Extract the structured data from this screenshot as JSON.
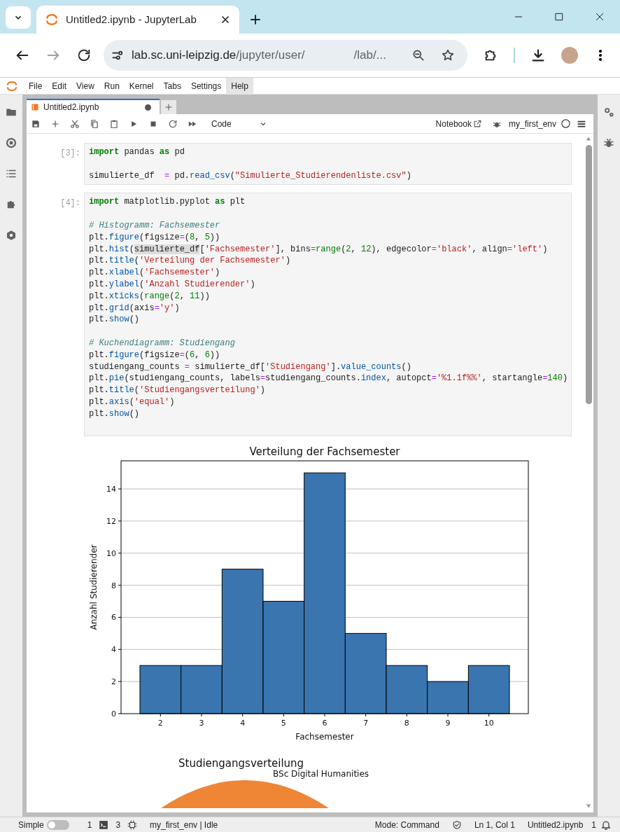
{
  "browser": {
    "tab_title": "Untitled2.ipynb - JupyterLab",
    "url_host": "lab.sc.uni-leipzig.de",
    "url_path": "/jupyter/user/",
    "url_tail": "/lab/...",
    "forward_disabled": true
  },
  "menu": [
    {
      "label": "File",
      "selected": false
    },
    {
      "label": "Edit",
      "selected": false
    },
    {
      "label": "View",
      "selected": false
    },
    {
      "label": "Run",
      "selected": false
    },
    {
      "label": "Kernel",
      "selected": false
    },
    {
      "label": "Tabs",
      "selected": false
    },
    {
      "label": "Settings",
      "selected": false
    },
    {
      "label": "Help",
      "selected": true
    }
  ],
  "document_tab": {
    "title": "Untitled2.ipynb",
    "modified": true
  },
  "toolbar": {
    "cell_type": "Code",
    "notebook_link": "Notebook",
    "kernel": "my_first_env"
  },
  "cells": [
    {
      "prompt": "[3]:",
      "blocks": [
        [
          [
            {
              "text": "import",
              "kind": "kw"
            },
            {
              "text": " pandas ",
              "kind": "p"
            },
            {
              "text": "as",
              "kind": "kw"
            },
            {
              "text": " pd",
              "kind": "p"
            }
          ]
        ],
        [
          [
            {
              "text": "simulierte_df  ",
              "kind": "p"
            },
            {
              "text": "=",
              "kind": "op"
            },
            {
              "text": " pd.",
              "kind": "p"
            },
            {
              "text": "read_csv",
              "kind": "fn"
            },
            {
              "text": "(",
              "kind": "p"
            },
            {
              "text": "\"Simulierte_Studierendenliste.csv\"",
              "kind": "str"
            },
            {
              "text": ")",
              "kind": "p"
            }
          ]
        ]
      ]
    },
    {
      "prompt": "[4]:",
      "blocks": [
        [
          [
            {
              "text": "import",
              "kind": "kw"
            },
            {
              "text": " matplotlib.pyplot ",
              "kind": "p"
            },
            {
              "text": "as",
              "kind": "kw"
            },
            {
              "text": " plt",
              "kind": "p"
            }
          ]
        ],
        [
          [
            {
              "text": "# Histogramm: Fachsemester",
              "kind": "cm"
            }
          ],
          [
            {
              "text": "plt.",
              "kind": "p"
            },
            {
              "text": "figure",
              "kind": "fn"
            },
            {
              "text": "(figsize",
              "kind": "p"
            },
            {
              "text": "=",
              "kind": "op"
            },
            {
              "text": "(",
              "kind": "p"
            },
            {
              "text": "8",
              "kind": "num"
            },
            {
              "text": ", ",
              "kind": "p"
            },
            {
              "text": "5",
              "kind": "num"
            },
            {
              "text": "))",
              "kind": "p"
            }
          ],
          [
            {
              "text": "plt.",
              "kind": "p"
            },
            {
              "text": "hist",
              "kind": "fn"
            },
            {
              "text": "(",
              "kind": "p"
            },
            {
              "text": "simulierte_df",
              "kind": "hl"
            },
            {
              "text": "[",
              "kind": "p"
            },
            {
              "text": "'Fachsemester'",
              "kind": "str"
            },
            {
              "text": "], bins",
              "kind": "p"
            },
            {
              "text": "=",
              "kind": "op"
            },
            {
              "text": "range",
              "kind": "bi"
            },
            {
              "text": "(",
              "kind": "p"
            },
            {
              "text": "2",
              "kind": "num"
            },
            {
              "text": ", ",
              "kind": "p"
            },
            {
              "text": "12",
              "kind": "num"
            },
            {
              "text": "), edgecolor",
              "kind": "p"
            },
            {
              "text": "=",
              "kind": "op"
            },
            {
              "text": "'black'",
              "kind": "str"
            },
            {
              "text": ", align",
              "kind": "p"
            },
            {
              "text": "=",
              "kind": "op"
            },
            {
              "text": "'left'",
              "kind": "str"
            },
            {
              "text": ")",
              "kind": "p"
            }
          ],
          [
            {
              "text": "plt.",
              "kind": "p"
            },
            {
              "text": "title",
              "kind": "fn"
            },
            {
              "text": "(",
              "kind": "p"
            },
            {
              "text": "'Verteilung der Fachsemester'",
              "kind": "str"
            },
            {
              "text": ")",
              "kind": "p"
            }
          ],
          [
            {
              "text": "plt.",
              "kind": "p"
            },
            {
              "text": "xlabel",
              "kind": "fn"
            },
            {
              "text": "(",
              "kind": "p"
            },
            {
              "text": "'Fachsemester'",
              "kind": "str"
            },
            {
              "text": ")",
              "kind": "p"
            }
          ],
          [
            {
              "text": "plt.",
              "kind": "p"
            },
            {
              "text": "ylabel",
              "kind": "fn"
            },
            {
              "text": "(",
              "kind": "p"
            },
            {
              "text": "'Anzahl Studierender'",
              "kind": "str"
            },
            {
              "text": ")",
              "kind": "p"
            }
          ],
          [
            {
              "text": "plt.",
              "kind": "p"
            },
            {
              "text": "xticks",
              "kind": "fn"
            },
            {
              "text": "(",
              "kind": "p"
            },
            {
              "text": "range",
              "kind": "bi"
            },
            {
              "text": "(",
              "kind": "p"
            },
            {
              "text": "2",
              "kind": "num"
            },
            {
              "text": ", ",
              "kind": "p"
            },
            {
              "text": "11",
              "kind": "num"
            },
            {
              "text": "))",
              "kind": "p"
            }
          ],
          [
            {
              "text": "plt.",
              "kind": "p"
            },
            {
              "text": "grid",
              "kind": "fn"
            },
            {
              "text": "(axis",
              "kind": "p"
            },
            {
              "text": "=",
              "kind": "op"
            },
            {
              "text": "'y'",
              "kind": "str"
            },
            {
              "text": ")",
              "kind": "p"
            }
          ],
          [
            {
              "text": "plt.",
              "kind": "p"
            },
            {
              "text": "show",
              "kind": "fn"
            },
            {
              "text": "()",
              "kind": "p"
            }
          ]
        ],
        [
          [
            {
              "text": "# Kuchendiagramm: Studiengang",
              "kind": "cm"
            }
          ],
          [
            {
              "text": "plt.",
              "kind": "p"
            },
            {
              "text": "figure",
              "kind": "fn"
            },
            {
              "text": "(figsize",
              "kind": "p"
            },
            {
              "text": "=",
              "kind": "op"
            },
            {
              "text": "(",
              "kind": "p"
            },
            {
              "text": "6",
              "kind": "num"
            },
            {
              "text": ", ",
              "kind": "p"
            },
            {
              "text": "6",
              "kind": "num"
            },
            {
              "text": "))",
              "kind": "p"
            }
          ],
          [
            {
              "text": "studiengang_counts ",
              "kind": "p"
            },
            {
              "text": "=",
              "kind": "op"
            },
            {
              "text": " simulierte_df[",
              "kind": "p"
            },
            {
              "text": "'Studiengang'",
              "kind": "str"
            },
            {
              "text": "].",
              "kind": "p"
            },
            {
              "text": "value_counts",
              "kind": "fn"
            },
            {
              "text": "()",
              "kind": "p"
            }
          ],
          [
            {
              "text": "plt.",
              "kind": "p"
            },
            {
              "text": "pie",
              "kind": "fn"
            },
            {
              "text": "(studiengang_counts, labels",
              "kind": "p"
            },
            {
              "text": "=",
              "kind": "op"
            },
            {
              "text": "studiengang_counts.",
              "kind": "p"
            },
            {
              "text": "index",
              "kind": "fn"
            },
            {
              "text": ", autopct",
              "kind": "p"
            },
            {
              "text": "=",
              "kind": "op"
            },
            {
              "text": "'%1.1f%%'",
              "kind": "str"
            },
            {
              "text": ", startangle",
              "kind": "p"
            },
            {
              "text": "=",
              "kind": "op"
            },
            {
              "text": "140",
              "kind": "num"
            },
            {
              "text": ")",
              "kind": "p"
            }
          ],
          [
            {
              "text": "plt.",
              "kind": "p"
            },
            {
              "text": "title",
              "kind": "fn"
            },
            {
              "text": "(",
              "kind": "p"
            },
            {
              "text": "'Studiengangsverteilung'",
              "kind": "str"
            },
            {
              "text": ")",
              "kind": "p"
            }
          ],
          [
            {
              "text": "plt.",
              "kind": "p"
            },
            {
              "text": "axis",
              "kind": "fn"
            },
            {
              "text": "(",
              "kind": "p"
            },
            {
              "text": "'equal'",
              "kind": "str"
            },
            {
              "text": ")",
              "kind": "p"
            }
          ],
          [
            {
              "text": "plt.",
              "kind": "p"
            },
            {
              "text": "show",
              "kind": "fn"
            },
            {
              "text": "()",
              "kind": "p"
            }
          ]
        ]
      ]
    }
  ],
  "histogram": {
    "chart_data": {
      "type": "bar",
      "title": "Verteilung der Fachsemester",
      "xlabel": "Fachsemester",
      "ylabel": "Anzahl Studierender",
      "categories": [
        "2",
        "3",
        "4",
        "5",
        "6",
        "7",
        "8",
        "9",
        "10"
      ],
      "series": [
        {
          "color": "#3a75af",
          "values": [
            3,
            3,
            9,
            7,
            15,
            5,
            3,
            2,
            3
          ]
        }
      ],
      "ylim": [
        0,
        15.75
      ],
      "yticks": [
        0,
        2,
        4,
        6,
        8,
        10,
        12,
        14
      ],
      "grid": true
    }
  },
  "pie_chart": {
    "title": "Studiengangsverteilung",
    "slice_label": "BSc Digital Humanities"
  },
  "status_bar": {
    "mode_label": "Simple",
    "simple_mode": false,
    "terminals": "1",
    "kernels": "3",
    "kernel_status": "my_first_env | Idle",
    "mode": "Mode: Command",
    "cursor": "Ln 1, Col 1",
    "file": "Untitled2.ipynb",
    "notifications": "1"
  }
}
